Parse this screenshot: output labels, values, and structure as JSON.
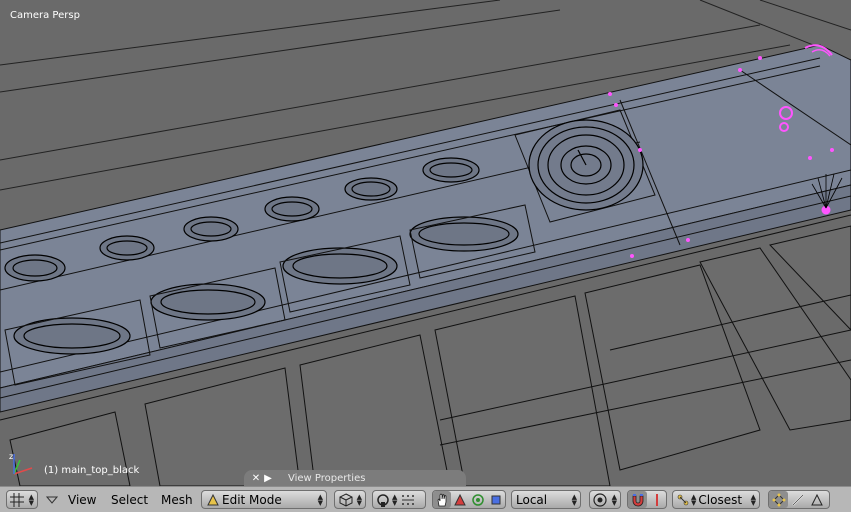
{
  "viewport": {
    "view_name": "Camera Persp",
    "object_name": "(1) main_top_black",
    "properties_tab": {
      "label": "View Properties"
    }
  },
  "header": {
    "menus": [
      "View",
      "Select",
      "Mesh"
    ],
    "mode": "Edit Mode",
    "orientation": "Local",
    "snap_target": "Closest"
  },
  "colors": {
    "viewport_bg": "#6a6a6a",
    "mesh_face": "#7b8496",
    "wire": "#0e0e0e",
    "selected_vertex": "#ff55ff",
    "header_bg": "#b7b7b7"
  },
  "icons": {
    "editor_type": "grid-icon",
    "draw_type": "cube-icon",
    "pivot": "pivot-icon",
    "manipulator_hand": "hand-icon",
    "manipulator_translate": "triangle-icon",
    "manipulator_rotate": "circle-icon",
    "manipulator_scale": "square-icon",
    "proportional": "proportional-icon",
    "snap_toggle": "magnet-icon",
    "snap_element": "snap-element-icon",
    "select_vertex": "vertex-select-icon",
    "select_edge": "edge-select-icon",
    "select_face": "face-select-icon"
  }
}
